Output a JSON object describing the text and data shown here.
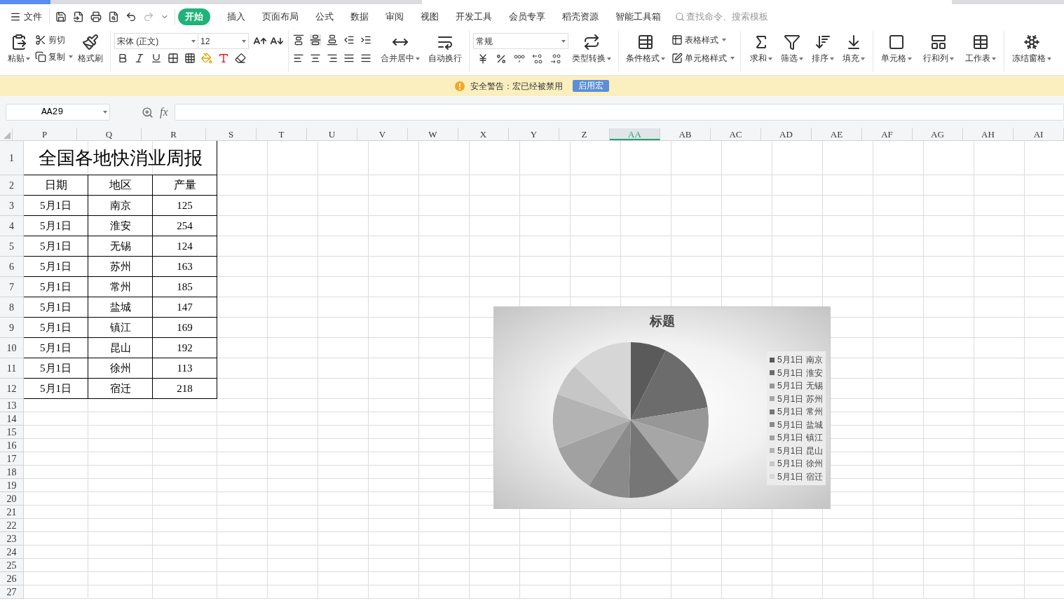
{
  "menu": {
    "file": "文件",
    "tabs": [
      {
        "label": "开始",
        "selected": true
      },
      {
        "label": "插入",
        "selected": false
      },
      {
        "label": "页面布局",
        "selected": false
      },
      {
        "label": "公式",
        "selected": false
      },
      {
        "label": "数据",
        "selected": false
      },
      {
        "label": "审阅",
        "selected": false
      },
      {
        "label": "视图",
        "selected": false
      },
      {
        "label": "开发工具",
        "selected": false
      },
      {
        "label": "会员专享",
        "selected": false
      },
      {
        "label": "稻壳资源",
        "selected": false
      },
      {
        "label": "智能工具箱",
        "selected": false
      }
    ],
    "search": {
      "placeholder": "查找命令、搜索模板"
    }
  },
  "ribbon": {
    "paste": "粘贴",
    "cut": "剪切",
    "copy": "复制",
    "format_painter": "格式刷",
    "font_name": "宋体 (正文)",
    "font_size": "12",
    "merge": "合并居中",
    "wrap": "自动换行",
    "number_format": "常规",
    "convert": "类型转换",
    "conditional_format": "条件格式",
    "table_style": "表格样式",
    "cell_style": "单元格样式",
    "tools": [
      {
        "label": "求和"
      },
      {
        "label": "筛选"
      },
      {
        "label": "排序"
      },
      {
        "label": "填充"
      }
    ],
    "cells": [
      {
        "label": "单元格"
      },
      {
        "label": "行和列"
      },
      {
        "label": "工作表"
      }
    ],
    "freeze": "冻结窗格"
  },
  "warning": {
    "text": "安全警告：宏已经被禁用",
    "button": "启用宏"
  },
  "formula_bar": {
    "name_box": "AA29",
    "fx": "fx"
  },
  "sheet": {
    "columns": [
      {
        "label": "P",
        "selected": false
      },
      {
        "label": "Q",
        "selected": false
      },
      {
        "label": "R",
        "selected": false
      },
      {
        "label": "S",
        "selected": false
      },
      {
        "label": "T",
        "selected": false
      },
      {
        "label": "U",
        "selected": false
      },
      {
        "label": "V",
        "selected": false
      },
      {
        "label": "W",
        "selected": false
      },
      {
        "label": "X",
        "selected": false
      },
      {
        "label": "Y",
        "selected": false
      },
      {
        "label": "Z",
        "selected": false
      },
      {
        "label": "AA",
        "selected": true
      },
      {
        "label": "AB",
        "selected": false
      },
      {
        "label": "AC",
        "selected": false
      },
      {
        "label": "AD",
        "selected": false
      },
      {
        "label": "AE",
        "selected": false
      },
      {
        "label": "AF",
        "selected": false
      },
      {
        "label": "AG",
        "selected": false
      },
      {
        "label": "AH",
        "selected": false
      },
      {
        "label": "AI",
        "selected": false
      }
    ],
    "rows": [
      "1",
      "2",
      "3",
      "4",
      "5",
      "6",
      "7",
      "8",
      "9",
      "10",
      "11",
      "12",
      "13",
      "14",
      "15",
      "16",
      "17",
      "18",
      "19",
      "20",
      "21",
      "22",
      "23",
      "24",
      "25",
      "26",
      "27"
    ],
    "title": "全国各地快消业周报",
    "headers": [
      "日期",
      "地区",
      "产量"
    ],
    "data": [
      [
        "5月1日",
        "南京",
        "125"
      ],
      [
        "5月1日",
        "淮安",
        "254"
      ],
      [
        "5月1日",
        "无锡",
        "124"
      ],
      [
        "5月1日",
        "苏州",
        "163"
      ],
      [
        "5月1日",
        "常州",
        "185"
      ],
      [
        "5月1日",
        "盐城",
        "147"
      ],
      [
        "5月1日",
        "镇江",
        "169"
      ],
      [
        "5月1日",
        "昆山",
        "192"
      ],
      [
        "5月1日",
        "徐州",
        "113"
      ],
      [
        "5月1日",
        "宿迁",
        "218"
      ]
    ]
  },
  "chart": {
    "chart_data": {
      "type": "pie",
      "title": "标题",
      "categories": [
        "5月1日 南京",
        "5月1日 淮安",
        "5月1日 无锡",
        "5月1日 苏州",
        "5月1日 常州",
        "5月1日 盐城",
        "5月1日 镇江",
        "5月1日 昆山",
        "5月1日 徐州",
        "5月1日 宿迁"
      ],
      "values": [
        7.4,
        15.03,
        7.34,
        9.64,
        10.95,
        8.7,
        10.0,
        11.36,
        6.69,
        12.89
      ],
      "colors": [
        "#5a5a5a",
        "#6c6c6c",
        "#979797",
        "#a6a6a6",
        "#767676",
        "#8a8a8a",
        "#a1a1a1",
        "#b3b3b3",
        "#c6c6c6",
        "#d6d6d6"
      ]
    }
  }
}
